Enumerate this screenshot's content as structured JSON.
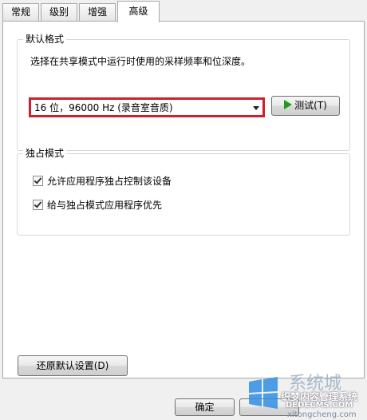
{
  "tabs": [
    {
      "label": "常规"
    },
    {
      "label": "级别"
    },
    {
      "label": "增强"
    },
    {
      "label": "高级",
      "active": true
    }
  ],
  "default_format": {
    "title": "默认格式",
    "description": "选择在共享模式中运行时使用的采样频率和位深度。",
    "selected": "16 位，96000 Hz (录音室音质)",
    "test_label": "测试(T)"
  },
  "exclusive_mode": {
    "title": "独占模式",
    "options": [
      {
        "label": "允许应用程序独占控制该设备",
        "checked": true
      },
      {
        "label": "给与独占模式应用程序优先",
        "checked": true
      }
    ]
  },
  "restore_defaults_label": "还原默认设置(D)",
  "footer": {
    "ok_label": "确定"
  },
  "watermark": {
    "line1": "系统城",
    "line2": "织梦内容管理系统",
    "line3": "DEDECMS.COM",
    "line4": "xitongcheng.com"
  }
}
